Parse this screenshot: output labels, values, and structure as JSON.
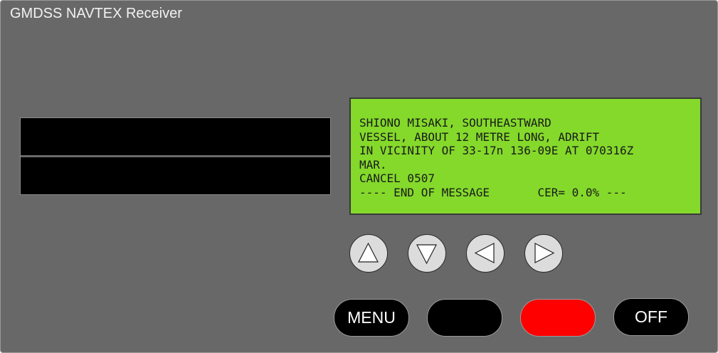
{
  "app": {
    "title": "GMDSS NAVTEX Receiver"
  },
  "lcd": {
    "lines": [
      "SHIONO MISAKI, SOUTHEASTWARD",
      "VESSEL, ABOUT 12 METRE LONG, ADRIFT",
      "IN VICINITY OF 33-17n 136-09E AT 070316Z",
      "MAR.",
      "CANCEL 0507",
      "---- END OF MESSAGE       CER= 0.0% ---"
    ]
  },
  "buttons": {
    "menu_label": "MENU",
    "blank_label": "",
    "red_label": "",
    "off_label": "OFF"
  },
  "nav": {
    "up": "triangle-up-icon",
    "down": "triangle-down-icon",
    "left": "triangle-left-icon",
    "right": "triangle-right-icon"
  },
  "colors": {
    "panel": "#686868",
    "lcd_background": "#84d92b",
    "stop_button": "#ff0000"
  }
}
